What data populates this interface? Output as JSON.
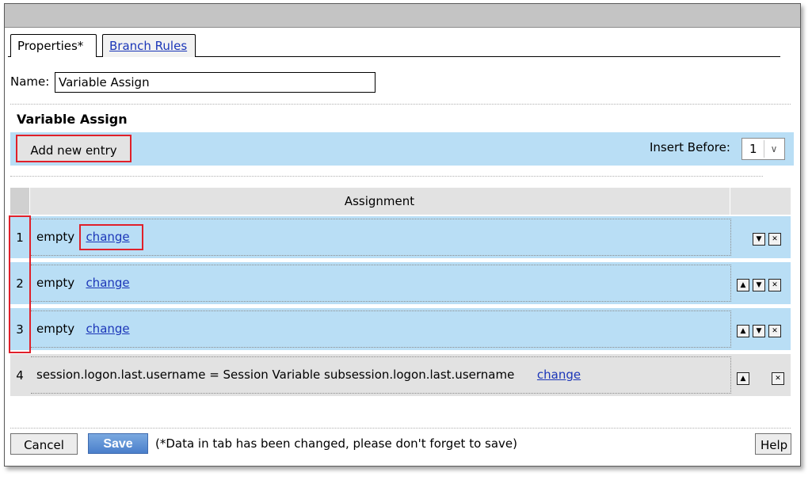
{
  "tabs": [
    {
      "label": "Properties*",
      "active": true
    },
    {
      "label": "Branch Rules",
      "active": false
    }
  ],
  "name_field": {
    "label": "Name:",
    "value": "Variable Assign"
  },
  "section_title": "Variable Assign",
  "toolbar": {
    "add_label": "Add new entry",
    "insert_before_label": "Insert Before:",
    "insert_before_value": "1"
  },
  "table": {
    "header": "Assignment",
    "rows": [
      {
        "num": "1",
        "text": "empty",
        "link": "change"
      },
      {
        "num": "2",
        "text": "empty",
        "link": "change"
      },
      {
        "num": "3",
        "text": "empty",
        "link": "change"
      },
      {
        "num": "4",
        "text": "session.logon.last.username = Session Variable subsession.logon.last.username",
        "link": "change"
      }
    ]
  },
  "footer": {
    "cancel_label": "Cancel",
    "save_label": "Save",
    "notice": "(*Data in tab has been changed, please don't forget to save)",
    "help_label": "Help"
  },
  "colors": {
    "row_blue": "#b9def5",
    "row_gray": "#e2e2e2",
    "highlight_red": "#e0202a",
    "link_blue": "#1b36b8"
  }
}
